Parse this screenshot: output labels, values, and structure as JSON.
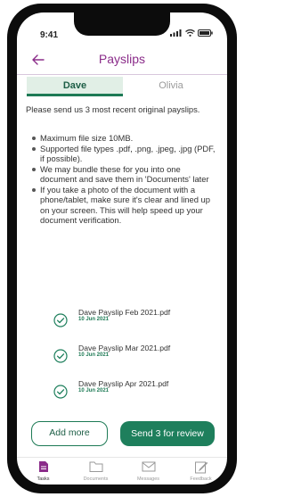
{
  "status_bar": {
    "time": "9:41"
  },
  "header": {
    "title": "Payslips"
  },
  "tabs": [
    {
      "label": "Dave",
      "active": true
    },
    {
      "label": "Olivia",
      "active": false
    }
  ],
  "intro": "Please send us 3 most recent original payslips.",
  "bullets": [
    "Maximum file size 10MB.",
    "Supported file types .pdf, .png, .jpeg, .jpg (PDF, if possible).",
    "We may bundle these for you into one document and save them in 'Documents' later",
    "If you take a photo of the document with a phone/tablet, make sure it's clear and lined up on your screen. This will help speed up your document verification."
  ],
  "files": [
    {
      "name": "Dave Payslip Feb 2021.pdf",
      "date": "10 Jun 2021"
    },
    {
      "name": "Dave Payslip Mar 2021.pdf",
      "date": "10 Jun 2021"
    },
    {
      "name": "Dave Payslip Apr 2021.pdf",
      "date": "10 Jun 2021"
    }
  ],
  "actions": {
    "add_more": "Add more",
    "send": "Send 3 for review"
  },
  "tabbar": [
    {
      "label": "Tasks",
      "icon": "tasks-icon",
      "active": true
    },
    {
      "label": "Documents",
      "icon": "folder-icon",
      "active": false
    },
    {
      "label": "Messages",
      "icon": "mail-icon",
      "active": false
    },
    {
      "label": "Feedback",
      "icon": "feedback-icon",
      "active": false
    }
  ],
  "colors": {
    "brand_purple": "#8b2d8a",
    "brand_green": "#1e7f5c",
    "tab_bg": "#e1efe6"
  }
}
